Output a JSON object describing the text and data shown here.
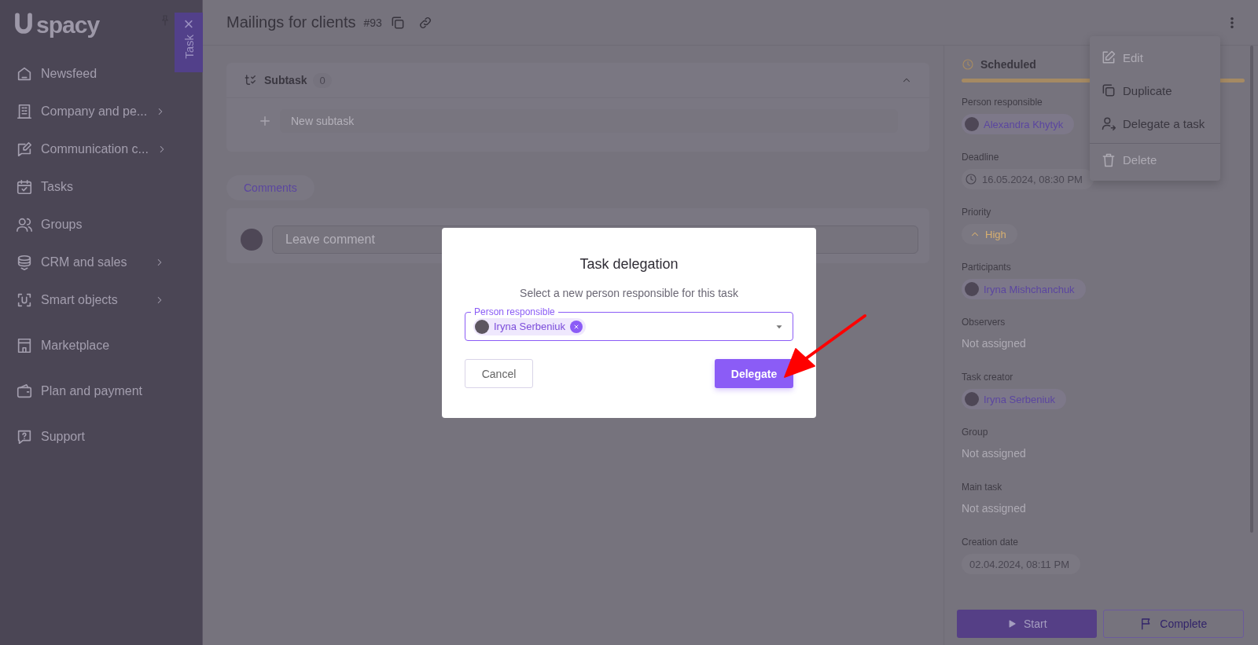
{
  "sidebar": {
    "logo_text": "spacy",
    "items": [
      {
        "label": "Newsfeed",
        "has_submenu": false
      },
      {
        "label": "Company and pe...",
        "has_submenu": true
      },
      {
        "label": "Communication c...",
        "has_submenu": true
      },
      {
        "label": "Tasks",
        "has_submenu": false
      },
      {
        "label": "Groups",
        "has_submenu": false
      },
      {
        "label": "CRM and sales",
        "has_submenu": true
      },
      {
        "label": "Smart objects",
        "has_submenu": true
      },
      {
        "label": "Marketplace",
        "has_submenu": false
      },
      {
        "label": "Plan and payment",
        "has_submenu": false
      },
      {
        "label": "Support",
        "has_submenu": false
      }
    ]
  },
  "task_tab": {
    "label": "Task",
    "close": "×"
  },
  "header": {
    "title": "Mailings for clients",
    "number": "#93"
  },
  "subtask": {
    "label": "Subtask",
    "count": "0",
    "expanded": true,
    "new_placeholder": "New subtask"
  },
  "comments": {
    "tab": {
      "label": "Comments",
      "selected": true
    },
    "placeholder": "Leave comment"
  },
  "details": {
    "status": "Scheduled",
    "fields": [
      {
        "label": "Person responsible",
        "kind": "person",
        "value": "Alexandra Khytyk"
      },
      {
        "label": "Deadline",
        "kind": "date",
        "value": "16.05.2024, 08:30 PM"
      },
      {
        "label": "Priority",
        "kind": "priority",
        "value": "High"
      },
      {
        "label": "Participants",
        "kind": "person",
        "value": "Iryna Mishchanchuk"
      },
      {
        "label": "Observers",
        "kind": "empty",
        "value": "Not assigned"
      },
      {
        "label": "Task creator",
        "kind": "person",
        "value": "Iryna Serbeniuk"
      },
      {
        "label": "Group",
        "kind": "empty",
        "value": "Not assigned"
      },
      {
        "label": "Main task",
        "kind": "empty",
        "value": "Not assigned"
      },
      {
        "label": "Creation date",
        "kind": "plain",
        "value": "02.04.2024, 08:11 PM"
      }
    ],
    "actions": [
      {
        "label": "Start",
        "kind": "primary"
      },
      {
        "label": "Complete",
        "kind": "secondary"
      }
    ]
  },
  "menu": {
    "items": [
      {
        "label": "Edit",
        "disabled": true,
        "divider_before": false
      },
      {
        "label": "Duplicate",
        "disabled": false,
        "divider_before": false
      },
      {
        "label": "Delegate a task",
        "disabled": false,
        "divider_before": false
      },
      {
        "label": "Delete",
        "disabled": true,
        "divider_before": true
      }
    ]
  },
  "modal": {
    "title": "Task delegation",
    "subtitle": "Select a new person responsible for this task",
    "field_label": "Person responsible",
    "selected_person": "Iryna Serbeniuk",
    "buttons": [
      {
        "label": "Cancel",
        "kind": "secondary"
      },
      {
        "label": "Delegate",
        "kind": "primary"
      }
    ]
  }
}
